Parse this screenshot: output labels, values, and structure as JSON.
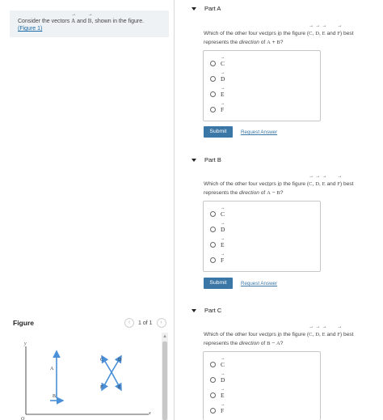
{
  "intro": {
    "text_prefix": "Consider the vectors ",
    "vec_a": "A",
    "and": " and ",
    "vec_b": "B",
    "text_suffix": ", shown in the figure.",
    "figure_link": "(Figure 1)"
  },
  "figure": {
    "label": "Figure",
    "pager_text": "1 of 1",
    "prev_icon": "chevron-left",
    "next_icon": "chevron-right",
    "axis_y": "y",
    "axis_x": "x",
    "origin": "O",
    "vec_labels": [
      "A",
      "B",
      "C",
      "D",
      "E",
      "F"
    ],
    "vector_color": "#4a90d9"
  },
  "parts": [
    {
      "title": "Part A",
      "q_prefix": "Which of the other four vectors in the figure (",
      "q_vecs": [
        "C",
        "D",
        "E",
        "F"
      ],
      "q_mid": ") best represents the ",
      "q_italic": "direction",
      "q_of": " of ",
      "q_expr_a": "A",
      "q_op": " + ",
      "q_expr_b": "B",
      "q_end": "?",
      "options": [
        "C",
        "D",
        "E",
        "F"
      ],
      "submit": "Submit",
      "request": "Request Answer"
    },
    {
      "title": "Part B",
      "q_prefix": "Which of the other four vectors in the figure (",
      "q_vecs": [
        "C",
        "D",
        "E",
        "F"
      ],
      "q_mid": ") best represents the ",
      "q_italic": "direction",
      "q_of": " of ",
      "q_expr_a": "A",
      "q_op": " − ",
      "q_expr_b": "B",
      "q_end": "?",
      "options": [
        "C",
        "D",
        "E",
        "F"
      ],
      "submit": "Submit",
      "request": "Request Answer"
    },
    {
      "title": "Part C",
      "q_prefix": "Which of the other four vectors in the figure (",
      "q_vecs": [
        "C",
        "D",
        "E",
        "F"
      ],
      "q_mid": ") best represents the ",
      "q_italic": "direction",
      "q_of": " of ",
      "q_expr_a": "B",
      "q_op": " − ",
      "q_expr_b": "A",
      "q_end": "?",
      "options": [
        "C",
        "D",
        "E",
        "F"
      ]
    }
  ],
  "colors": {
    "accent": "#3a76a6",
    "intro_bg": "#eef2f5"
  }
}
